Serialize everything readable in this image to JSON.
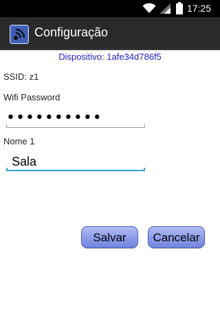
{
  "status_bar": {
    "time": "17:25",
    "icons": [
      "wifi-icon",
      "signal-icon",
      "battery-icon"
    ]
  },
  "action_bar": {
    "title": "Configuração",
    "icon": "wireless-app-icon"
  },
  "device": {
    "text": "Dispositivo: 1afe34d786f5"
  },
  "ssid": {
    "text": "SSID: z1"
  },
  "password": {
    "label": "Wifi Password",
    "value": "••••••••••"
  },
  "name": {
    "label": "Nome 1",
    "value": "Sala"
  },
  "buttons": {
    "save_label": "Salvar",
    "cancel_label": "Cancelar"
  },
  "colors": {
    "status_bar": "#000000",
    "action_bar": "#2a2a2a",
    "device_text": "#2222cc",
    "focus_underline": "#2e9fd8",
    "button": "#8f9ee8"
  }
}
